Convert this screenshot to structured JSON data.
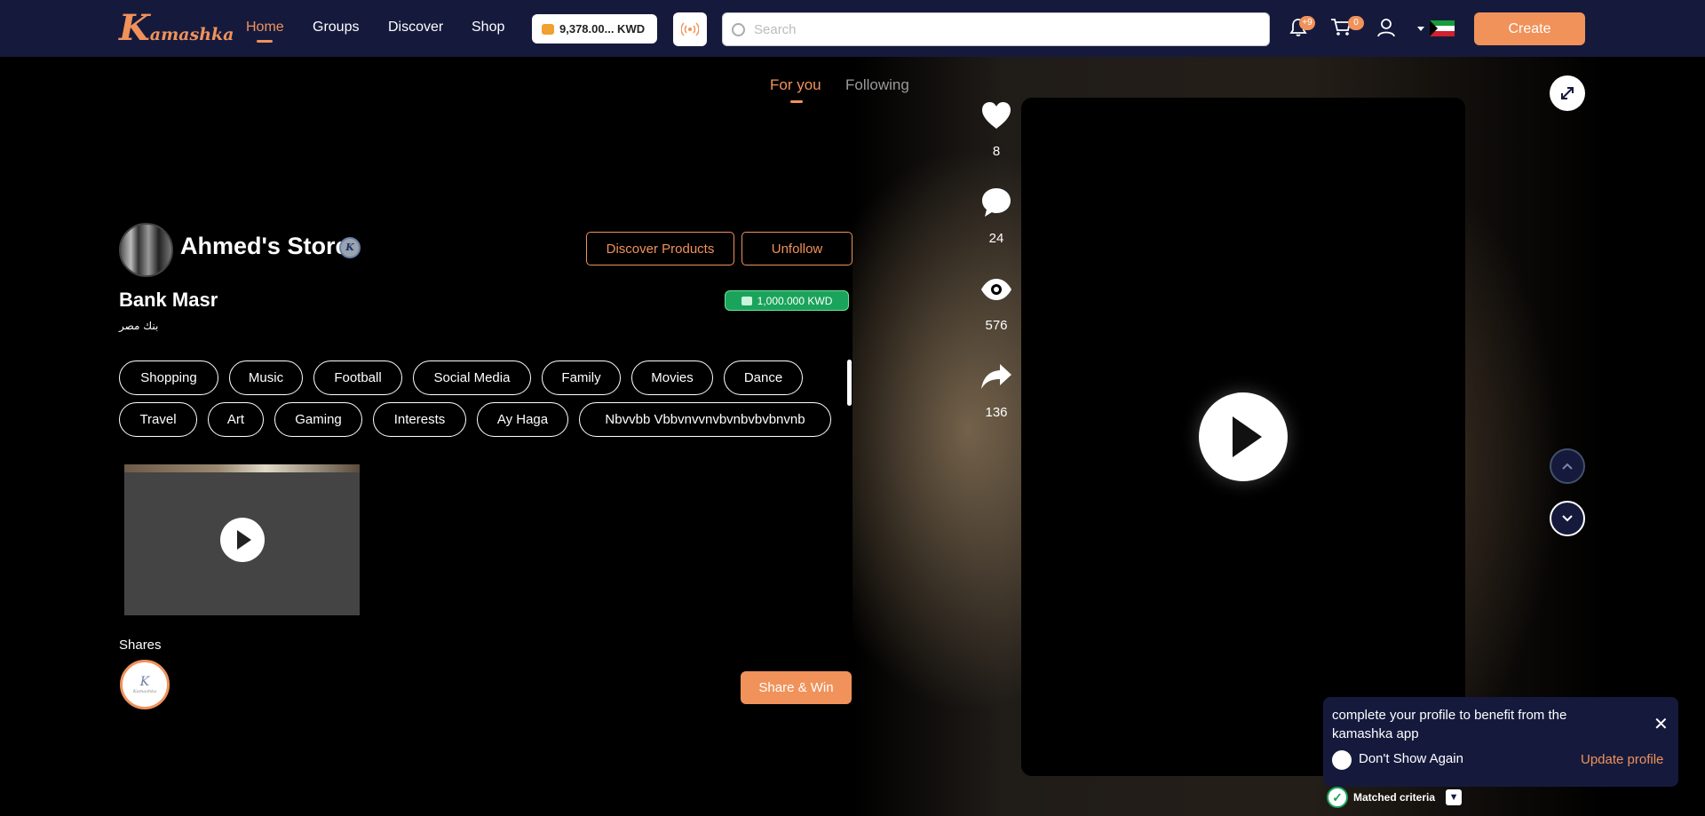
{
  "app": {
    "logo_big": "K",
    "logo_rest": "amashka",
    "brand_color": "#f0925a",
    "header_bg": "#151a3d"
  },
  "nav": {
    "items": [
      {
        "label": "Home",
        "active": true
      },
      {
        "label": "Groups",
        "active": false
      },
      {
        "label": "Discover",
        "active": false
      },
      {
        "label": "Shop",
        "active": false
      }
    ]
  },
  "wallet": {
    "balance": "9,378.00... KWD",
    "icon": "coins-icon"
  },
  "live": {
    "icon": "broadcast-icon"
  },
  "search": {
    "placeholder": "Search",
    "value": ""
  },
  "notifications": {
    "count": "+9",
    "icon": "bell-icon"
  },
  "cart": {
    "count": "0",
    "icon": "cart-icon"
  },
  "profile": {
    "icon": "user-icon"
  },
  "language": {
    "flag": "kuwait-flag"
  },
  "create_label": "Create",
  "feed_tabs": [
    {
      "label": "For you",
      "active": true
    },
    {
      "label": "Following",
      "active": false
    }
  ],
  "store": {
    "name": "Ahmed's Store",
    "verified_mark": "K",
    "discover_products_label": "Discover Products",
    "unfollow_label": "Unfollow",
    "bank_name": "Bank Masr",
    "bank_arabic": "بنك مصر",
    "balance": "1,000.000 KWD",
    "balance_color": "#1aa35a"
  },
  "tags": [
    "Shopping",
    "Music",
    "Football",
    "Social Media",
    "Family",
    "Movies",
    "Dance",
    "Travel",
    "Art",
    "Gaming",
    "Interests",
    "Ay Haga",
    "Nbvvbb Vbbvnvvnvbvnbvbvbnvnb"
  ],
  "shares": {
    "label": "Shares",
    "avatar_mark": "K",
    "avatar_text": "Kamashka",
    "share_win_label": "Share & Win"
  },
  "actions": {
    "likes": "8",
    "comments": "24",
    "views": "576",
    "shares": "136"
  },
  "popup": {
    "message": "complete your profile to benefit from the kamashka app",
    "dont_show_label": "Don't Show Again",
    "update_label": "Update profile"
  },
  "matched_label": "Matched criteria"
}
